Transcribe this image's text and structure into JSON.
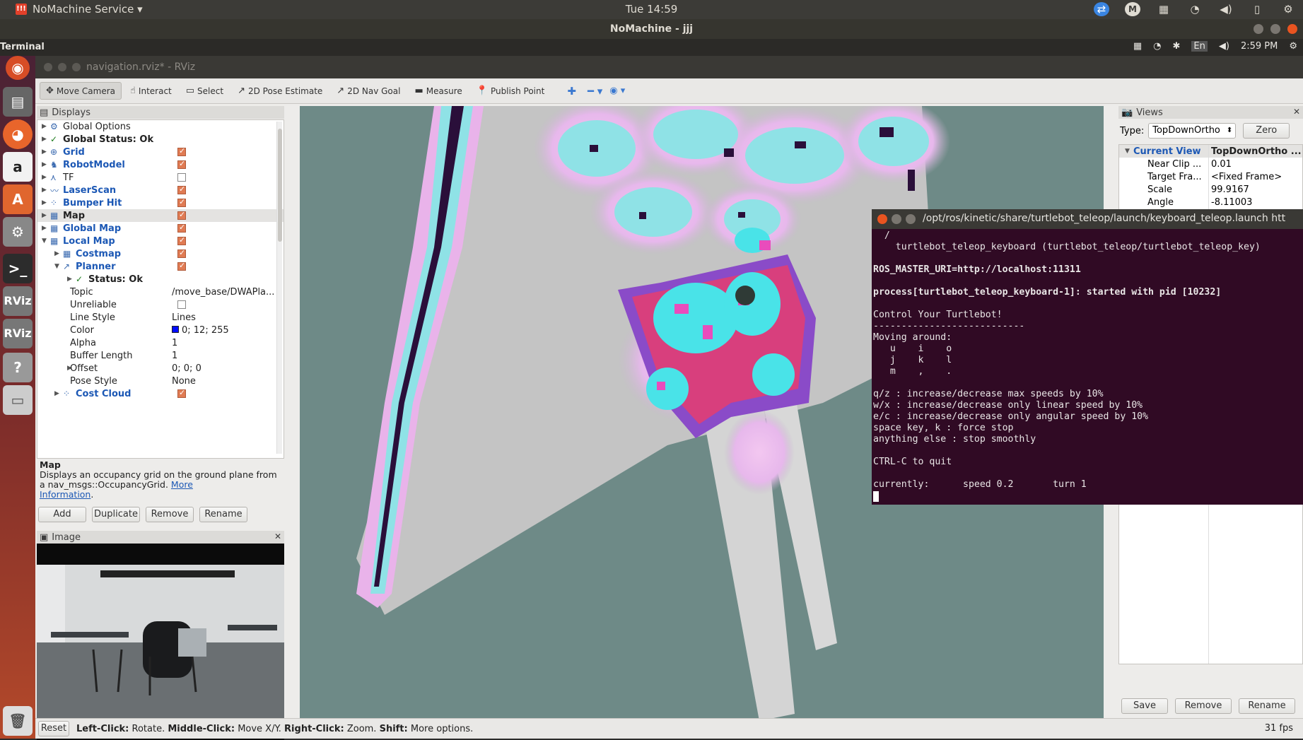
{
  "host": {
    "app_menu": "NoMachine Service ▾",
    "clock": "Tue 14:59",
    "window_title": "NoMachine - jjj"
  },
  "remote": {
    "app_name": "Terminal",
    "time": "2:59 PM",
    "lang": "En"
  },
  "rviz": {
    "title": "navigation.rviz* - RViz",
    "toolbar": [
      {
        "label": "Move Camera",
        "icon": "move-camera-icon",
        "glyph": "✥",
        "active": true
      },
      {
        "label": "Interact",
        "icon": "interact-icon",
        "glyph": "☝",
        "active": false
      },
      {
        "label": "Select",
        "icon": "select-icon",
        "glyph": "▭",
        "active": false
      },
      {
        "label": "2D Pose Estimate",
        "icon": "pose-estimate-icon",
        "glyph": "↗",
        "active": false
      },
      {
        "label": "2D Nav Goal",
        "icon": "nav-goal-icon",
        "glyph": "↗",
        "active": false
      },
      {
        "label": "Measure",
        "icon": "measure-icon",
        "glyph": "▬",
        "active": false
      },
      {
        "label": "Publish Point",
        "icon": "publish-point-icon",
        "glyph": "📍",
        "active": false
      }
    ],
    "displays": {
      "header": "Displays",
      "rows": [
        {
          "label": "Global Options",
          "style": "normal"
        },
        {
          "label": "Global Status: Ok",
          "style": "normal"
        },
        {
          "label": "Grid",
          "style": "blue"
        },
        {
          "label": "RobotModel",
          "style": "blue"
        },
        {
          "label": "TF",
          "style": "normal"
        },
        {
          "label": "LaserScan",
          "style": "blue"
        },
        {
          "label": "Bumper Hit",
          "style": "blue"
        },
        {
          "label": "Map",
          "style": "bold"
        },
        {
          "label": "Global Map",
          "style": "blue"
        },
        {
          "label": "Local Map",
          "style": "blue"
        },
        {
          "label": "Costmap",
          "style": "blue"
        },
        {
          "label": "Planner",
          "style": "blue"
        },
        {
          "label": "Status: Ok",
          "style": "normal"
        },
        {
          "label": "Topic",
          "value": "/move_base/DWAPla...",
          "style": "normal"
        },
        {
          "label": "Unreliable",
          "value": "",
          "style": "normal"
        },
        {
          "label": "Line Style",
          "value": "Lines",
          "style": "normal"
        },
        {
          "label": "Color",
          "value": "0; 12; 255",
          "style": "normal"
        },
        {
          "label": "Alpha",
          "value": "1",
          "style": "normal"
        },
        {
          "label": "Buffer Length",
          "value": "1",
          "style": "normal"
        },
        {
          "label": "Offset",
          "value": "0; 0; 0",
          "style": "normal"
        },
        {
          "label": "Pose Style",
          "value": "None",
          "style": "normal"
        },
        {
          "label": "Cost Cloud",
          "style": "blue"
        }
      ],
      "description": {
        "title": "Map",
        "text": "Displays an occupancy grid on the ground plane from a nav_msgs::OccupancyGrid.",
        "link1": "More",
        "link2": "Information"
      },
      "buttons": {
        "add": "Add",
        "duplicate": "Duplicate",
        "remove": "Remove",
        "rename": "Rename"
      }
    },
    "image_panel": {
      "header": "Image"
    },
    "views": {
      "header": "Views",
      "type_label": "Type:",
      "type_value": "TopDownOrtho",
      "zero": "Zero",
      "current_view": "Current View",
      "current_view_type": "TopDownOrtho ...",
      "props": [
        {
          "k": "Near Clip ...",
          "v": "0.01"
        },
        {
          "k": "Target Fra...",
          "v": "<Fixed Frame>"
        },
        {
          "k": "Scale",
          "v": "99.9167"
        },
        {
          "k": "Angle",
          "v": "-8.11003"
        }
      ],
      "buttons": {
        "save": "Save",
        "remove": "Remove",
        "rename": "Rename"
      }
    },
    "status": {
      "reset": "Reset",
      "left": "Left-Click:",
      "left_t": "Rotate.",
      "middle": "Middle-Click:",
      "middle_t": "Move X/Y.",
      "right": "Right-Click:",
      "right_t": "Zoom.",
      "shift": "Shift:",
      "shift_t": "More options.",
      "fps": "31 fps"
    }
  },
  "terminal": {
    "title": "/opt/ros/kinetic/share/turtlebot_teleop/launch/keyboard_teleop.launch htt",
    "lines": [
      "  /",
      "    turtlebot_teleop_keyboard (turtlebot_teleop/turtlebot_teleop_key)",
      "",
      "ROS_MASTER_URI=http://localhost:11311",
      "",
      "process[turtlebot_teleop_keyboard-1]: started with pid [10232]",
      "",
      "Control Your Turtlebot!",
      "---------------------------",
      "Moving around:",
      "   u    i    o",
      "   j    k    l",
      "   m    ,    .",
      "",
      "q/z : increase/decrease max speeds by 10%",
      "w/x : increase/decrease only linear speed by 10%",
      "e/c : increase/decrease only angular speed by 10%",
      "space key, k : force stop",
      "anything else : stop smoothly",
      "",
      "CTRL-C to quit",
      "",
      "currently:      speed 0.2       turn 1"
    ]
  }
}
